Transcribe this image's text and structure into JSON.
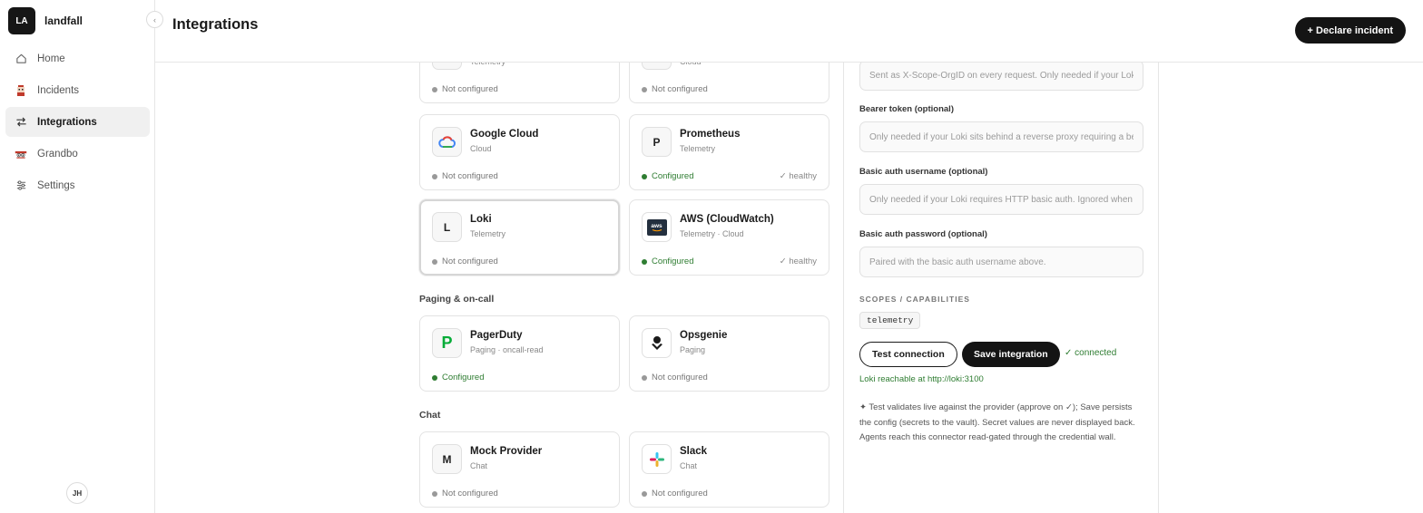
{
  "workspace": {
    "initials": "LA",
    "name": "landfall",
    "collapse_glyph": "‹"
  },
  "sidebar": {
    "items": [
      {
        "label": "Home",
        "icon": "home-icon",
        "active": false
      },
      {
        "label": "Incidents",
        "icon": "incidents-mascot-icon",
        "active": false
      },
      {
        "label": "Integrations",
        "icon": "arrows-swap-icon",
        "active": true
      },
      {
        "label": "Grandbo",
        "icon": "grandbo-mascot-icon",
        "active": false
      },
      {
        "label": "Settings",
        "icon": "sliders-icon",
        "active": false
      }
    ],
    "user_initials": "JH"
  },
  "header": {
    "title": "Integrations",
    "declare_label": "+ Declare incident"
  },
  "cards": {
    "partial_left": {
      "name": "",
      "category": "Telemetry",
      "status": "Not configured"
    },
    "partial_right": {
      "name": "",
      "category": "Cloud",
      "status": "Not configured"
    },
    "google_cloud": {
      "name": "Google Cloud",
      "category": "Cloud",
      "status": "Not configured"
    },
    "prometheus": {
      "name": "Prometheus",
      "category": "Telemetry",
      "icon_letter": "P",
      "status": "Configured",
      "health": "✓ healthy"
    },
    "loki": {
      "name": "Loki",
      "category": "Telemetry",
      "icon_letter": "L",
      "status": "Not configured"
    },
    "aws": {
      "name": "AWS (CloudWatch)",
      "category": "Telemetry · Cloud",
      "icon_text": "aws",
      "status": "Configured",
      "health": "✓ healthy"
    },
    "pagerduty": {
      "name": "PagerDuty",
      "category": "Paging · oncall-read",
      "icon_letter": "P",
      "status": "Configured"
    },
    "opsgenie": {
      "name": "Opsgenie",
      "category": "Paging",
      "status": "Not configured"
    },
    "mock_provider": {
      "name": "Mock Provider",
      "category": "Chat",
      "icon_letter": "M",
      "status": "Not configured"
    },
    "slack": {
      "name": "Slack",
      "category": "Chat",
      "status": "Not configured"
    }
  },
  "sections": {
    "paging": "Paging & on-call",
    "chat": "Chat"
  },
  "config": {
    "org_id_placeholder": "Sent as X-Scope-OrgID on every request. Only needed if your Loki is multi-tenant.",
    "bearer_label": "Bearer token (optional)",
    "bearer_placeholder": "Only needed if your Loki sits behind a reverse proxy requiring a bearer token.",
    "basic_user_label": "Basic auth username (optional)",
    "basic_user_placeholder": "Only needed if your Loki requires HTTP basic auth. Ignored when a bearer token is set.",
    "basic_pass_label": "Basic auth password (optional)",
    "basic_pass_placeholder": "Paired with the basic auth username above.",
    "scopes_label": "SCOPES / CAPABILITIES",
    "scope_chip": "telemetry",
    "test_label": "Test connection",
    "save_label": "Save integration",
    "connected_text": "✓ connected",
    "reach_text": "Loki reachable at http://loki:3100",
    "note": "✦ Test validates live against the provider (approve on ✓); Save persists the config (secrets to the vault). Secret values are never displayed back. Agents reach this connector read-gated through the credential wall."
  },
  "colors": {
    "accent_dark": "#141414",
    "ok_green": "#2f7d32",
    "muted": "#888888"
  }
}
